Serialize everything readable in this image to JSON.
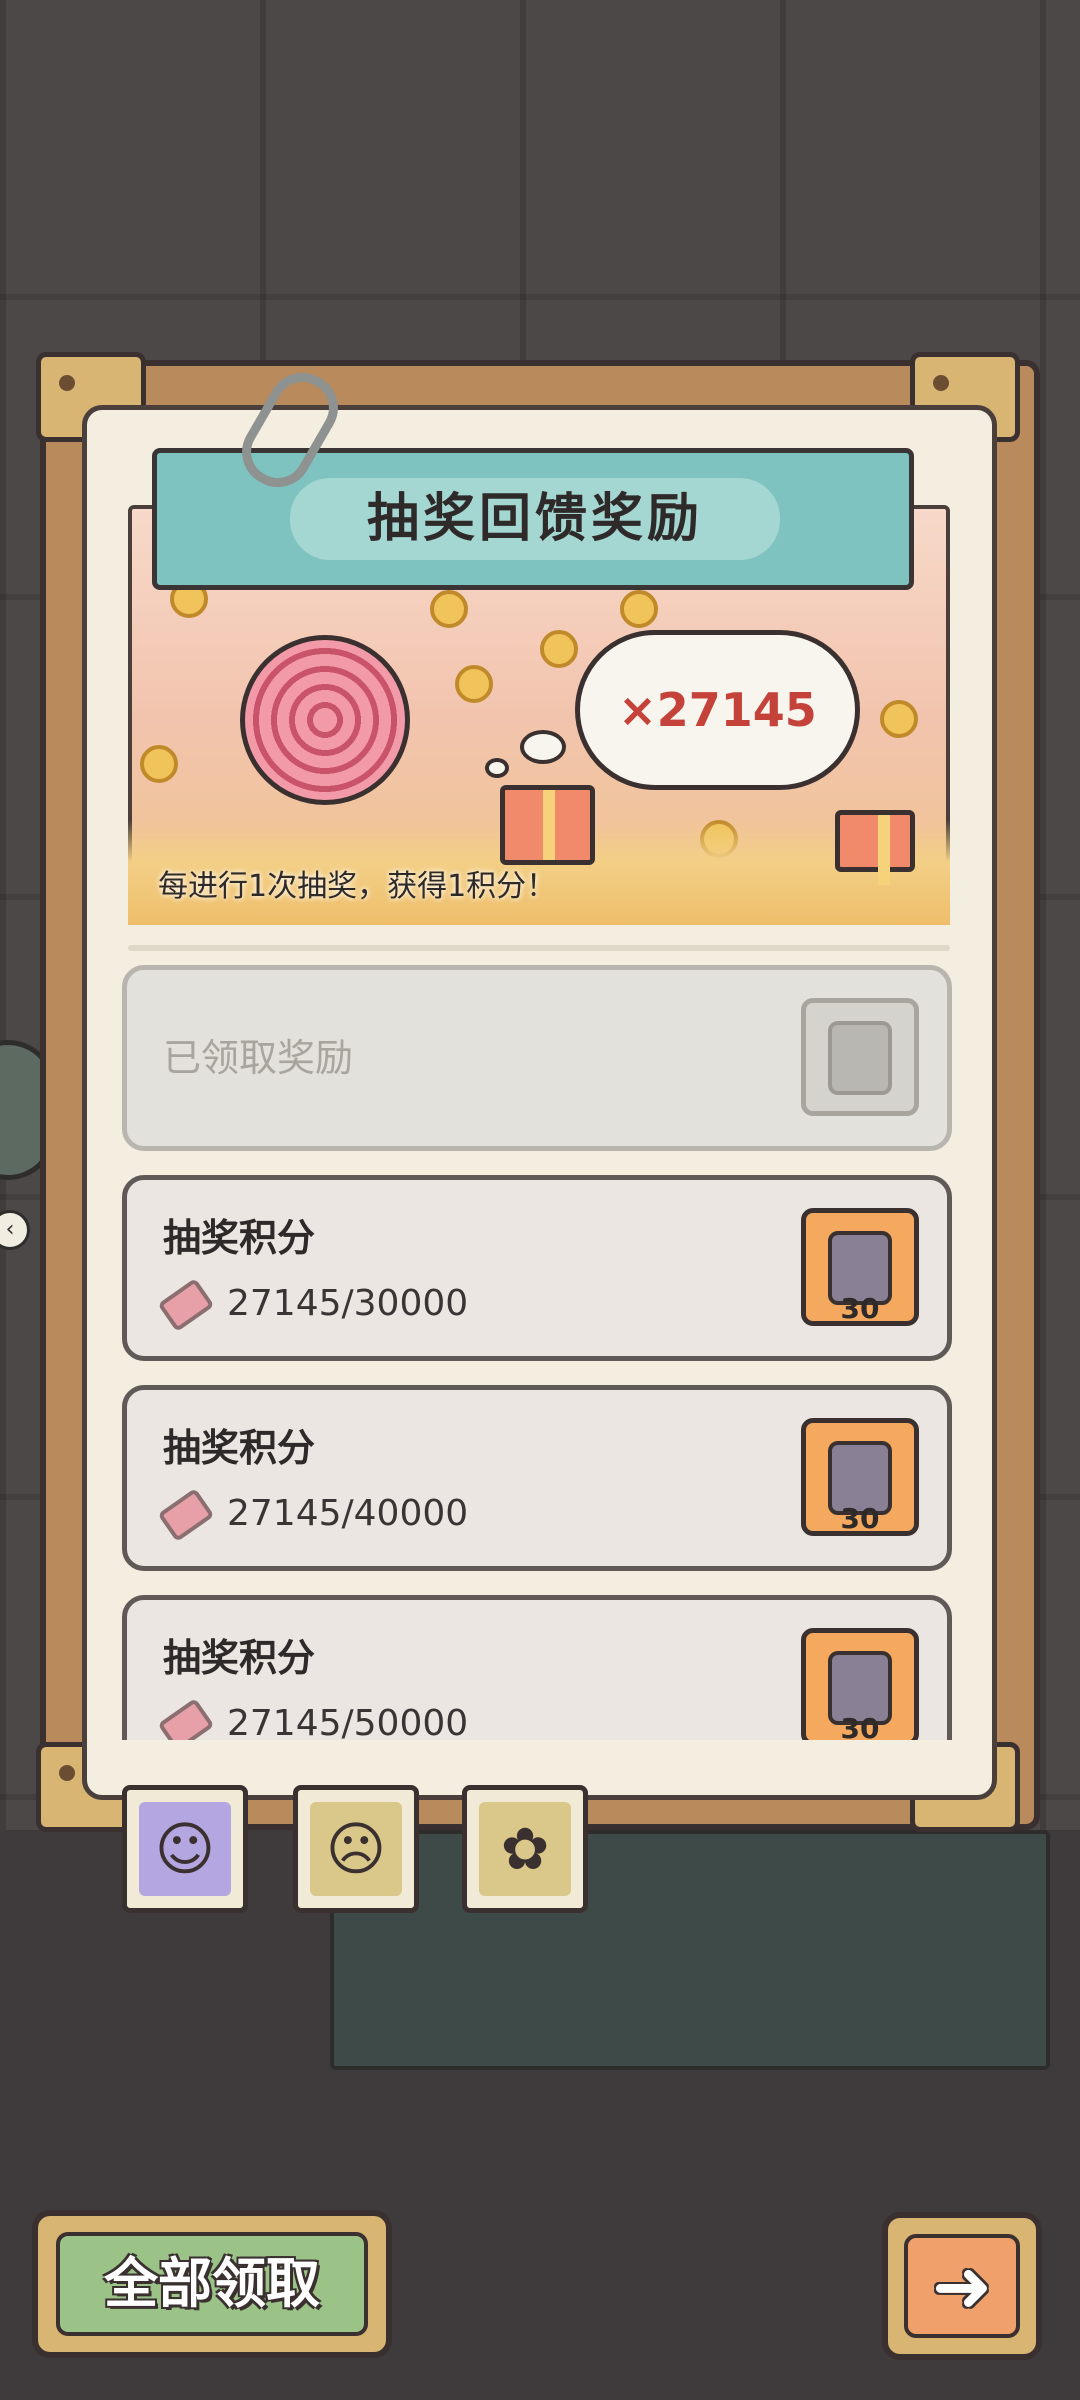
{
  "header": {
    "title": "抽奖回馈奖励"
  },
  "banner": {
    "points_display": "×27145",
    "caption": "每进行1次抽奖，获得1积分！"
  },
  "rewards": [
    {
      "title": "已领取奖励",
      "claimed": true,
      "progress": "",
      "reward_count": ""
    },
    {
      "title": "抽奖积分",
      "claimed": false,
      "progress": "27145/30000",
      "reward_count": "30"
    },
    {
      "title": "抽奖积分",
      "claimed": false,
      "progress": "27145/40000",
      "reward_count": "30"
    },
    {
      "title": "抽奖积分",
      "claimed": false,
      "progress": "27145/50000",
      "reward_count": "30"
    }
  ],
  "tabs": [
    {
      "icon": "doll-icon",
      "active": true
    },
    {
      "icon": "voodoo-doll-icon",
      "active": false
    },
    {
      "icon": "gift-box-icon",
      "active": false
    }
  ],
  "buttons": {
    "claim_all_label": "全部领取",
    "next_icon": "arrow-right-icon"
  },
  "colors": {
    "header_teal": "#7fc3c0",
    "reward_orange": "#f4a95e",
    "claim_green": "#9bc287",
    "points_red": "#c4423a"
  }
}
